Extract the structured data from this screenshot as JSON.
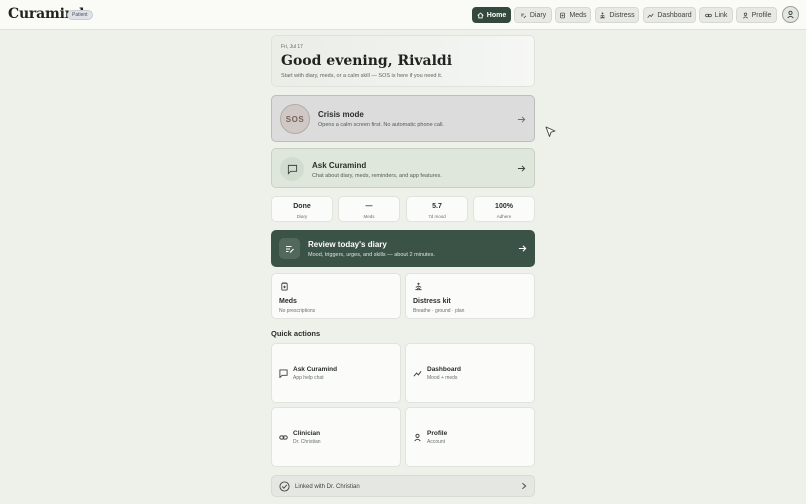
{
  "app": {
    "brand": "Curamind",
    "role_badge": "Patient"
  },
  "nav": [
    {
      "label": "Home",
      "icon": "home-icon",
      "active": true
    },
    {
      "label": "Diary",
      "icon": "diary-icon"
    },
    {
      "label": "Meds",
      "icon": "meds-icon"
    },
    {
      "label": "Distress",
      "icon": "distress-icon"
    },
    {
      "label": "Dashboard",
      "icon": "trend-icon"
    },
    {
      "label": "Link",
      "icon": "link-icon"
    },
    {
      "label": "Profile",
      "icon": "user-icon"
    }
  ],
  "hero": {
    "date": "Fri, Jul 17",
    "greeting": "Good evening, Rivaldi",
    "subtitle": "Start with diary, meds, or a calm skill — SOS is here if you need it."
  },
  "crisis": {
    "badge": "SOS",
    "title": "Crisis mode",
    "subtitle": "Opens a calm screen first. No automatic phone call."
  },
  "ask": {
    "title": "Ask Curamind",
    "subtitle": "Chat about diary, meds, reminders, and app features."
  },
  "stats": [
    {
      "value": "Done",
      "label": "Diary"
    },
    {
      "value": "—",
      "label": "Meds"
    },
    {
      "value": "5.7",
      "label": "7d mood"
    },
    {
      "value": "100%",
      "label": "Adhere"
    }
  ],
  "review": {
    "title": "Review today's diary",
    "subtitle": "Mood, triggers, urges, and skills — about 2 minutes."
  },
  "tiles": {
    "meds": {
      "title": "Meds",
      "subtitle": "No prescriptions"
    },
    "distress": {
      "title": "Distress kit",
      "subtitle": "Breathe · ground · plan"
    }
  },
  "quick_actions": {
    "title": "Quick actions",
    "items": [
      {
        "title": "Ask Curamind",
        "subtitle": "App help chat"
      },
      {
        "title": "Dashboard",
        "subtitle": "Mood + meds"
      },
      {
        "title": "Clinician",
        "subtitle": "Dr. Christian"
      },
      {
        "title": "Profile",
        "subtitle": "Account"
      }
    ]
  },
  "linked": {
    "text": "Linked with Dr. Christian"
  },
  "colors": {
    "accent": "#34493e",
    "review_bg": "#3b5347",
    "crisis_bg": "#dcdcdc",
    "ask_bg": "#dfe7dc"
  }
}
